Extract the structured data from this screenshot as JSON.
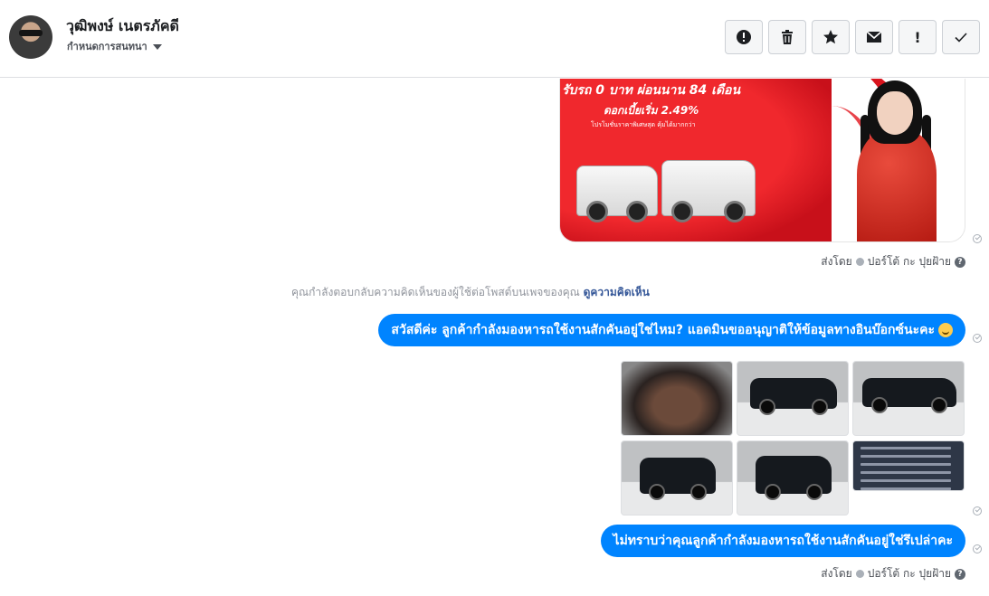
{
  "header": {
    "name": "วุฒิพงษ์ เนตรภัคดี",
    "subtitle": "กำหนดการสนทนา"
  },
  "toolbar": {
    "icons": [
      "alert-circle-icon",
      "trash-icon",
      "star-icon",
      "envelope-icon",
      "exclamation-icon",
      "checkmark-icon"
    ],
    "bang": "!"
  },
  "thread": {
    "promo": {
      "line1": "รับรถ 0 บาท ผ่อนนาน 84 เดือน",
      "line2": "ดอกเบี้ยเริ่ม 2.49%",
      "line3": "โปรโมชั่นราคาพิเศษสุด คุ้มได้มากกว่า"
    },
    "sent_by": {
      "label": "ส่งโดย",
      "agent": "ปอร์โต้ กะ ปุยฝ้าย",
      "help": "?"
    },
    "notice": {
      "text": "คุณกำลังตอบกลับความคิดเห็นของผู้ใช้ต่อโพสต์บนเพจของคุณ",
      "link": "ดูความคิดเห็น"
    },
    "message1": "สวัสดีค่ะ ลูกค้ากำลังมองหารถใช้งานสักคันอยู่ใช่ไหม? แอดมินขออนุญาติให้ข้อมูลทางอินบ๊อกซ์นะคะ",
    "message2": "ไม่ทราบว่าคุณลูกค้ากำลังมองหารถใช้งานสักคันอยู่ใช่รึเปล่าคะ"
  }
}
